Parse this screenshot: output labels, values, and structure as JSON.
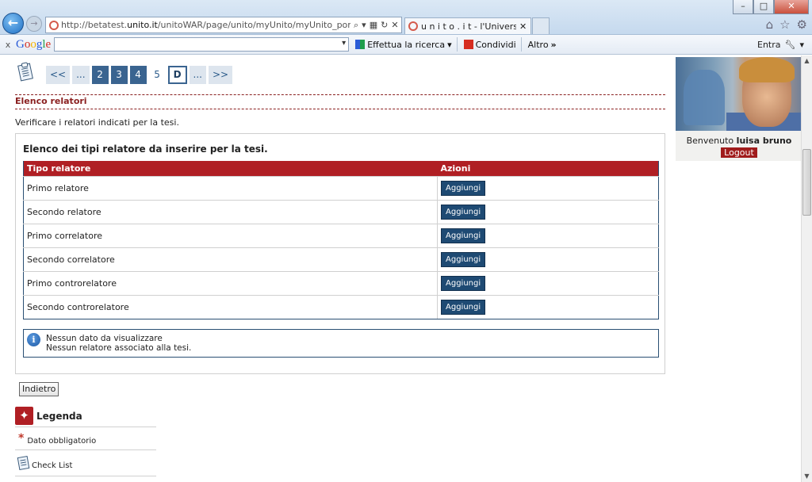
{
  "browser": {
    "url_prefix": "http://betatest.",
    "url_domain": "unito.it",
    "url_rest": "/unitoWAR/page/unito/myUnito/myUnito_portal_page_segrete",
    "tab_title": "u n i t o . i t - l'Università di ...",
    "window_controls": [
      "–",
      "□",
      "✕"
    ],
    "chrome_icons": [
      "home-icon",
      "star-icon",
      "gear-icon"
    ]
  },
  "googlebar": {
    "close": "x",
    "logo": "Google",
    "search_value": "",
    "search_label": "Effettua la ricerca",
    "share_label": "Condividi",
    "more_label": "Altro",
    "signin_label": "Entra"
  },
  "pager": {
    "items": [
      "<<",
      "...",
      "2",
      "3",
      "4",
      "5",
      "D",
      "...",
      ">>"
    ],
    "current": "D"
  },
  "section": {
    "title": "Elenco relatori",
    "intro": "Verificare i relatori indicati per la tesi."
  },
  "panel": {
    "title": "Elenco dei tipi relatore da inserire per la tesi.",
    "columns": [
      "Tipo relatore",
      "Azioni"
    ],
    "rows": [
      {
        "type": "Primo relatore",
        "action": "Aggiungi"
      },
      {
        "type": "Secondo relatore",
        "action": "Aggiungi"
      },
      {
        "type": "Primo correlatore",
        "action": "Aggiungi"
      },
      {
        "type": "Secondo correlatore",
        "action": "Aggiungi"
      },
      {
        "type": "Primo controrelatore",
        "action": "Aggiungi"
      },
      {
        "type": "Secondo controrelatore",
        "action": "Aggiungi"
      }
    ],
    "info_line1": "Nessun dato da visualizzare",
    "info_line2": "Nessun relatore associato alla tesi."
  },
  "actions": {
    "back_label": "Indietro"
  },
  "legend": {
    "title": "Legenda",
    "items": [
      {
        "icon": "asterisk-icon",
        "label": "Dato obbligatorio"
      },
      {
        "icon": "checklist-icon",
        "label": "Check List"
      }
    ]
  },
  "user": {
    "welcome": "Benvenuto",
    "name": "luisa bruno",
    "logout_label": "Logout"
  },
  "colors": {
    "accent_red": "#b01f24",
    "button_blue": "#1e4a73",
    "pager_blue": "#3a6490"
  }
}
